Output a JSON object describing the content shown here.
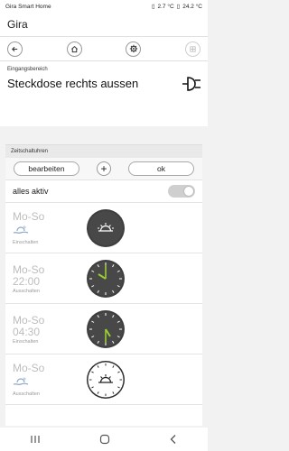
{
  "status": {
    "app_name": "Gira Smart Home",
    "temp1": "2.7 °C",
    "temp2": "24.2 °C"
  },
  "appbar": {
    "title": "Gira"
  },
  "toolbar": {
    "icons": [
      "back-icon",
      "home-icon",
      "settings-icon",
      "grid-icon"
    ]
  },
  "device": {
    "section": "Eingangsbereich",
    "name": "Steckdose rechts aussen",
    "icon": "plug-icon"
  },
  "timers": {
    "header": "Zeitschaltuhren",
    "edit_label": "bearbeiten",
    "add_label": "+",
    "ok_label": "ok",
    "all_active_label": "alles aktiv",
    "all_active_on": false,
    "items": [
      {
        "days": "Mo-So",
        "time": "",
        "mode": "Einschalten",
        "kind": "astro",
        "dial": "dark-sunrise"
      },
      {
        "days": "Mo-So",
        "time": "22:00",
        "mode": "Ausschalten",
        "kind": "time",
        "dial": "dark-clock"
      },
      {
        "days": "Mo-So",
        "time": "04:30",
        "mode": "Einschalten",
        "kind": "time",
        "dial": "dark-clock"
      },
      {
        "days": "Mo-So",
        "time": "",
        "mode": "Ausschalten",
        "kind": "astro",
        "dial": "light-sunset"
      }
    ]
  },
  "colors": {
    "accent_green": "#9acd32",
    "dial_dark": "#4a4a4a",
    "muted": "#bdbdbd"
  }
}
